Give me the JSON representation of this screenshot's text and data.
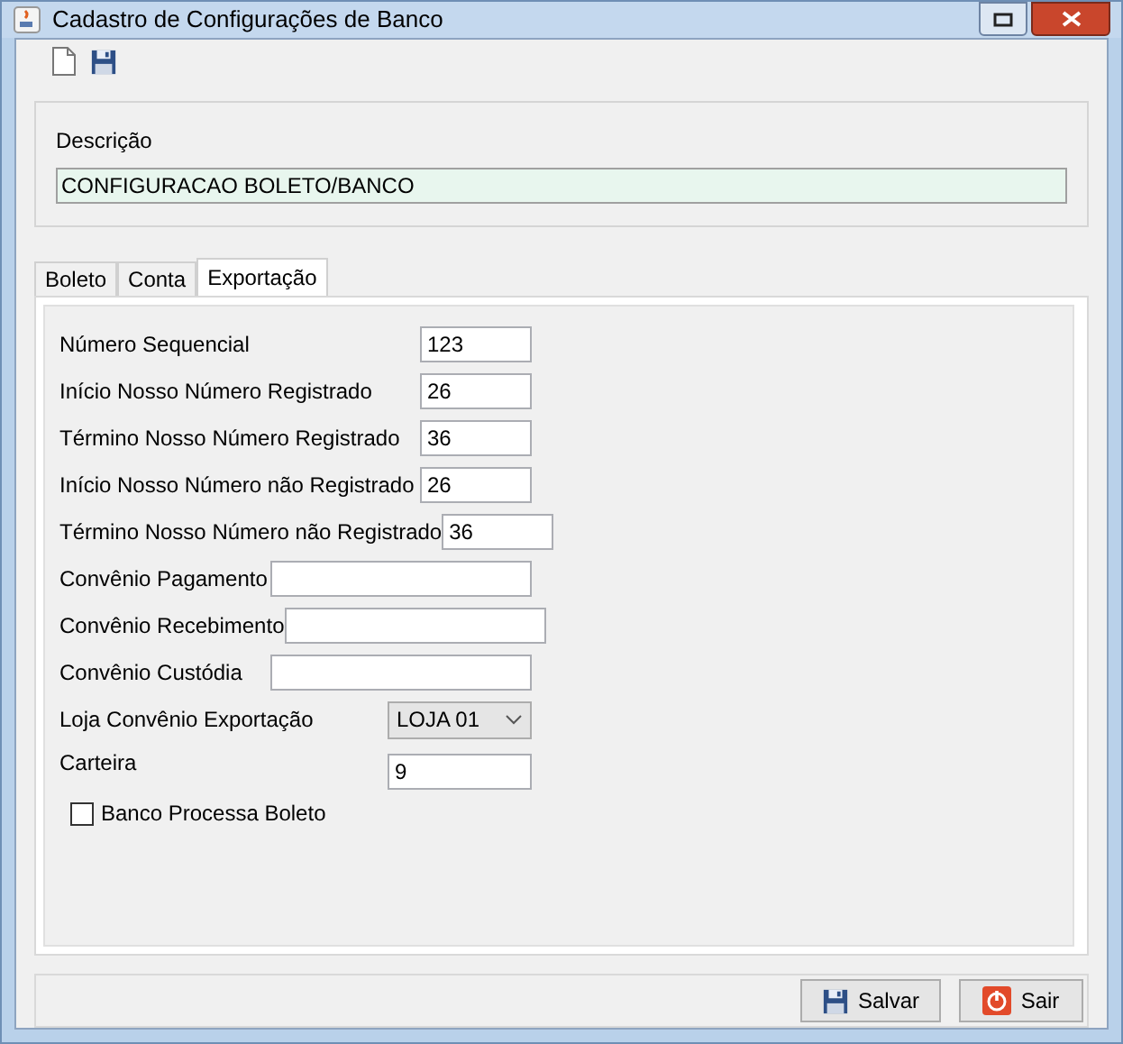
{
  "window": {
    "title": "Cadastro de Configurações de Banco"
  },
  "description": {
    "label": "Descrição",
    "value": "CONFIGURACAO BOLETO/BANCO"
  },
  "tabs": [
    {
      "label": "Boleto",
      "selected": false
    },
    {
      "label": "Conta",
      "selected": false
    },
    {
      "label": "Exportação",
      "selected": true
    }
  ],
  "fields": [
    {
      "label": "Número Sequencial",
      "value": "123",
      "kind": "short"
    },
    {
      "label": "Início Nosso Número Registrado",
      "value": "26",
      "kind": "short"
    },
    {
      "label": "Término Nosso Número Registrado",
      "value": "36",
      "kind": "short"
    },
    {
      "label": "Início Nosso Número não Registrado",
      "value": "26",
      "kind": "short"
    },
    {
      "label": "Término Nosso Número não Registrado",
      "value": "36",
      "kind": "short"
    },
    {
      "label": "Convênio Pagamento",
      "kind": "wide"
    },
    {
      "label": "Convênio Recebimento",
      "kind": "wide"
    },
    {
      "label": "Convênio Custódia",
      "kind": "wide"
    },
    {
      "label": "Loja Convênio Exportação",
      "value": "LOJA 01",
      "kind": "combo"
    },
    {
      "label": "Carteira",
      "value": "9",
      "kind": "medium"
    }
  ],
  "checkbox": {
    "label": "Banco Processa Boleto",
    "checked": false
  },
  "buttons": [
    {
      "label": "Salvar",
      "kind": "save"
    },
    {
      "label": "Sair",
      "kind": "exit"
    }
  ]
}
